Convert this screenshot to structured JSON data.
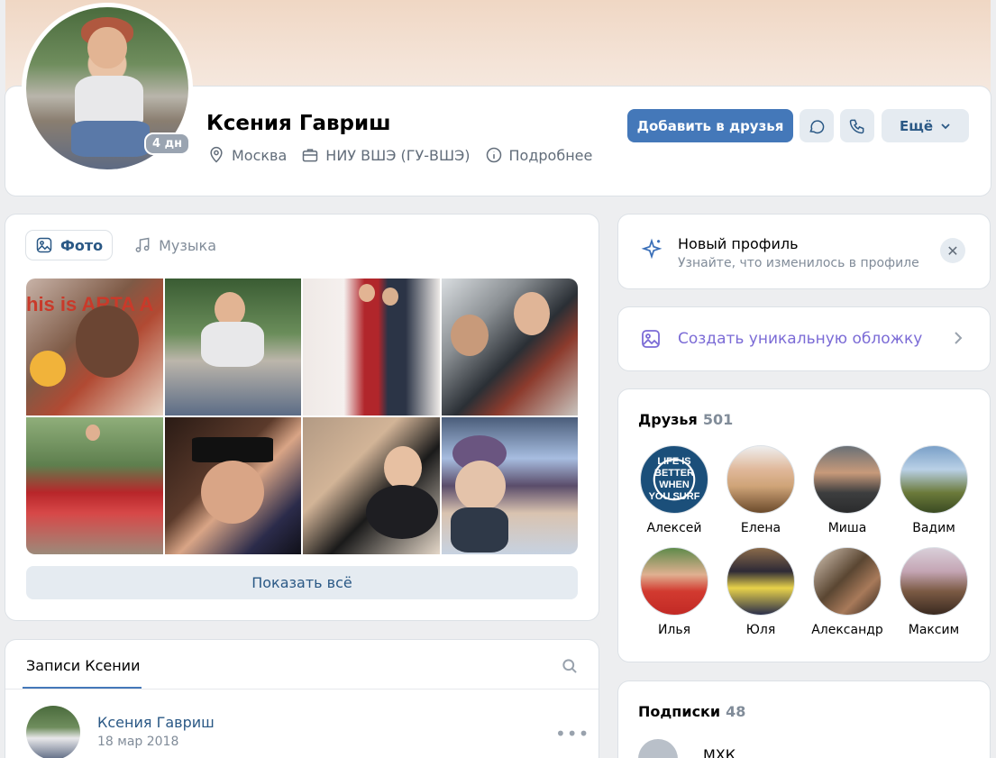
{
  "profile": {
    "name": "Ксения Гавриш",
    "online_badge": "4 дн",
    "city": "Москва",
    "university": "НИУ ВШЭ (ГУ-ВШЭ)",
    "details_label": "Подробнее"
  },
  "actions": {
    "add_friend": "Добавить в друзья",
    "more": "Ещё"
  },
  "media_tabs": [
    {
      "label": "Фото",
      "active": true
    },
    {
      "label": "Музыка",
      "active": false
    }
  ],
  "photos": {
    "show_all": "Показать всё",
    "photo1_text": "his is ARTA A"
  },
  "posts": {
    "tab_label": "Записи Ксении",
    "first_post": {
      "author": "Ксения Гавриш",
      "date": "18 мар 2018"
    }
  },
  "new_profile": {
    "title": "Новый профиль",
    "subtitle": "Узнайте, что изменилось в профиле"
  },
  "cover": {
    "label": "Создать уникальную обложку"
  },
  "friends": {
    "title": "Друзья",
    "count": "501",
    "items": [
      {
        "name": "Алексей"
      },
      {
        "name": "Елена"
      },
      {
        "name": "Миша"
      },
      {
        "name": "Вадим"
      },
      {
        "name": "Илья"
      },
      {
        "name": "Юля"
      },
      {
        "name": "Александр"
      },
      {
        "name": "Максим"
      }
    ],
    "alexey_avatar_text": "LIFE IS BETTER WHEN YOU SURF"
  },
  "subscriptions": {
    "title": "Подписки",
    "count": "48",
    "first": "МХК"
  },
  "colors": {
    "accent": "#4478b9",
    "link": "#2a5885",
    "secondary_text": "#818c99",
    "cover_accent": "#7b6bd6"
  }
}
